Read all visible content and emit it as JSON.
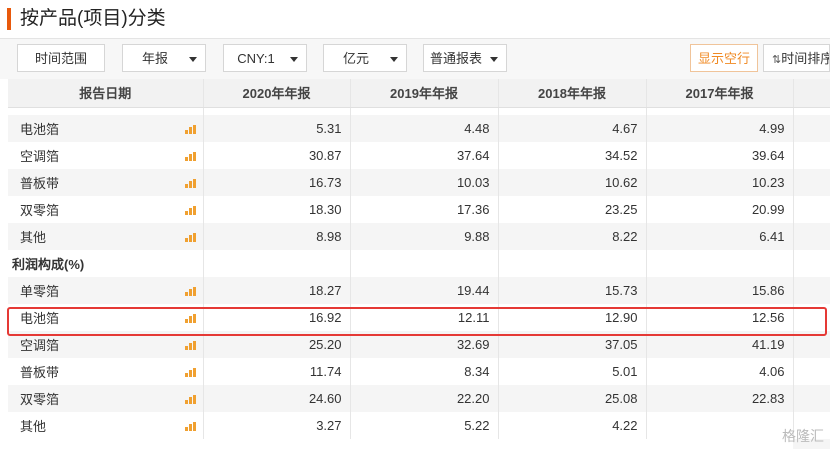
{
  "title": "按产品(项目)分类",
  "toolbar": {
    "time_range": "时间范围",
    "period": "年报",
    "currency": "CNY:1",
    "unit": "亿元",
    "report_type": "普通报表",
    "show_empty": "显示空行",
    "sort_icon": "⇅",
    "sort_label": "时间排序"
  },
  "table": {
    "headers": [
      "报告日期",
      "2020年年报",
      "2019年年报",
      "2018年年报",
      "2017年年报"
    ],
    "rows": [
      {
        "name": "电池箔",
        "values": [
          "5.31",
          "4.48",
          "4.67",
          "4.99"
        ]
      },
      {
        "name": "空调箔",
        "values": [
          "30.87",
          "37.64",
          "34.52",
          "39.64"
        ]
      },
      {
        "name": "普板带",
        "values": [
          "16.73",
          "10.03",
          "10.62",
          "10.23"
        ]
      },
      {
        "name": "双零箔",
        "values": [
          "18.30",
          "17.36",
          "23.25",
          "20.99"
        ]
      },
      {
        "name": "其他",
        "values": [
          "8.98",
          "9.88",
          "8.22",
          "6.41"
        ]
      }
    ],
    "section_label": "利润构成(%)",
    "profit_rows": [
      {
        "name": "单零箔",
        "values": [
          "18.27",
          "19.44",
          "15.73",
          "15.86"
        ]
      },
      {
        "name": "电池箔",
        "values": [
          "16.92",
          "12.11",
          "12.90",
          "12.56"
        ]
      },
      {
        "name": "空调箔",
        "values": [
          "25.20",
          "32.69",
          "37.05",
          "41.19"
        ]
      },
      {
        "name": "普板带",
        "values": [
          "11.74",
          "8.34",
          "5.01",
          "4.06"
        ]
      },
      {
        "name": "双零箔",
        "values": [
          "24.60",
          "22.20",
          "25.08",
          "22.83"
        ]
      },
      {
        "name": "其他",
        "values": [
          "3.27",
          "5.22",
          "4.22",
          ""
        ]
      }
    ]
  },
  "watermark": "格隆汇"
}
